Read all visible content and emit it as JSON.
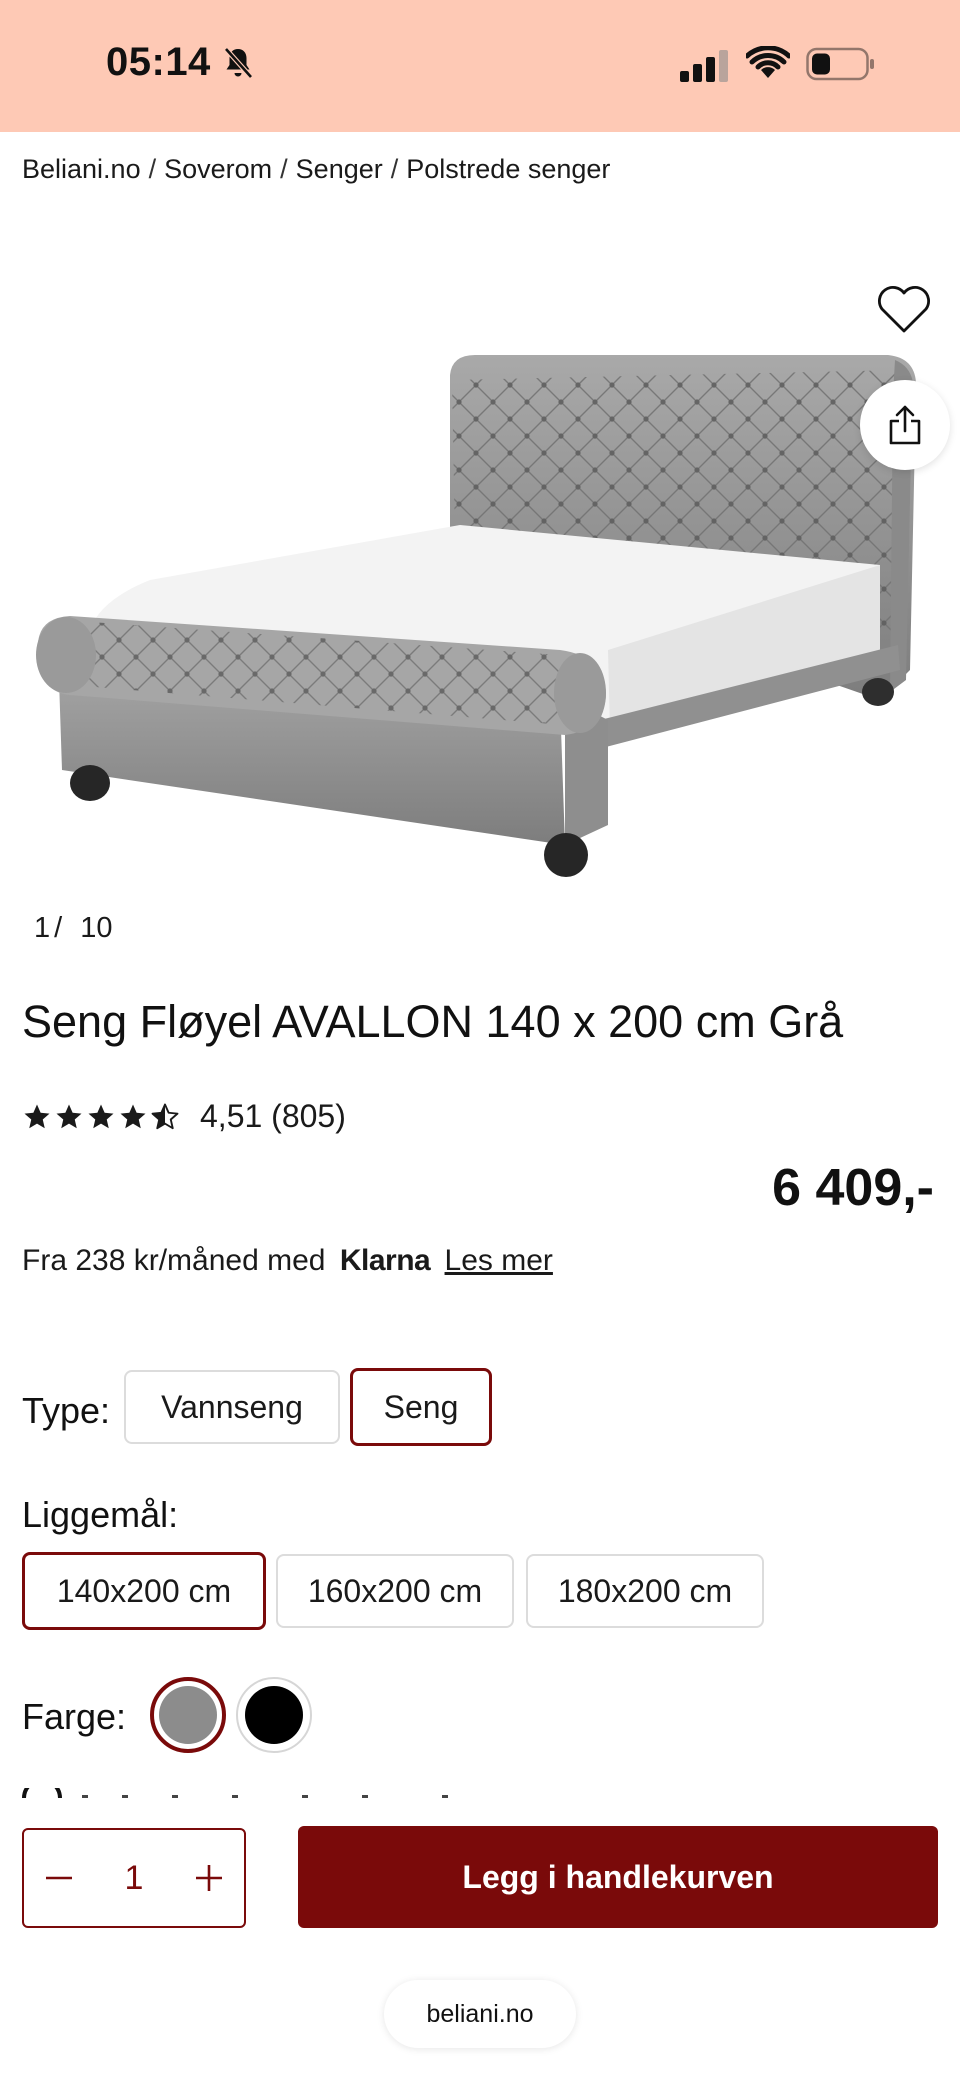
{
  "status_bar": {
    "time": "05:14",
    "background_color": "#fec9b5",
    "icons": [
      "bell-slash-icon",
      "signal-icon",
      "wifi-icon",
      "battery-icon"
    ]
  },
  "breadcrumb": {
    "items": [
      "Beliani.no",
      "Soverom",
      "Senger",
      "Polstrede senger"
    ],
    "separator": "/"
  },
  "gallery": {
    "current": "1",
    "separator": "/",
    "total": "10",
    "icons": [
      "heart-icon",
      "share-icon"
    ]
  },
  "product": {
    "title": "Seng Fløyel AVALLON 140 x 200 cm Grå",
    "rating_value": 4.51,
    "rating_max": 5,
    "rating_text": "4,51 (805)",
    "price": "6 409,-"
  },
  "financing": {
    "prefix": "Fra 238 kr/måned med",
    "brand": "Klarna",
    "link": "Les mer"
  },
  "options": {
    "type_label": "Type:",
    "types": [
      "Vannseng",
      "Seng"
    ],
    "type_selected": "Seng",
    "size_label": "Liggemål:",
    "sizes": [
      "140x200 cm",
      "160x200 cm",
      "180x200 cm"
    ],
    "size_selected": "140x200 cm",
    "color_label": "Farge:",
    "colors": [
      "#8c8c8c",
      "#000000"
    ],
    "color_selected": "#8c8c8c"
  },
  "cart": {
    "quantity": "1",
    "button_label": "Legg i handlekurven",
    "accent_color": "#7a0a0a"
  },
  "browser": {
    "url": "beliani.no"
  }
}
